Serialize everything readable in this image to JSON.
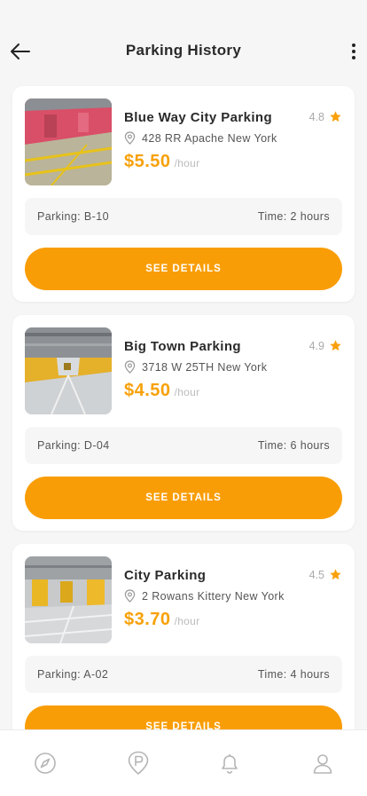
{
  "header": {
    "title": "Parking History"
  },
  "history": [
    {
      "name": "Blue Way City Parking",
      "rating": "4.8",
      "address": "428 RR Apache New York",
      "price": "$5.50",
      "unit": "/hour",
      "slot": "Parking: B-10",
      "time": "Time: 2 hours",
      "button": "SEE DETAILS"
    },
    {
      "name": "Big Town Parking",
      "rating": "4.9",
      "address": "3718 W 25TH New York",
      "price": "$4.50",
      "unit": "/hour",
      "slot": "Parking: D-04",
      "time": "Time: 6 hours",
      "button": "SEE DETAILS"
    },
    {
      "name": "City Parking",
      "rating": "4.5",
      "address": "2 Rowans Kittery New York",
      "price": "$3.70",
      "unit": "/hour",
      "slot": "Parking: A-02",
      "time": "Time: 4 hours",
      "button": "SEE DETAILS"
    }
  ],
  "tabbar": {
    "icons": [
      "compass-icon",
      "parking-icon",
      "bell-icon",
      "user-icon"
    ]
  },
  "colors": {
    "accent": "#f99d06",
    "price": "#f7a109",
    "star": "#f9a00b"
  }
}
